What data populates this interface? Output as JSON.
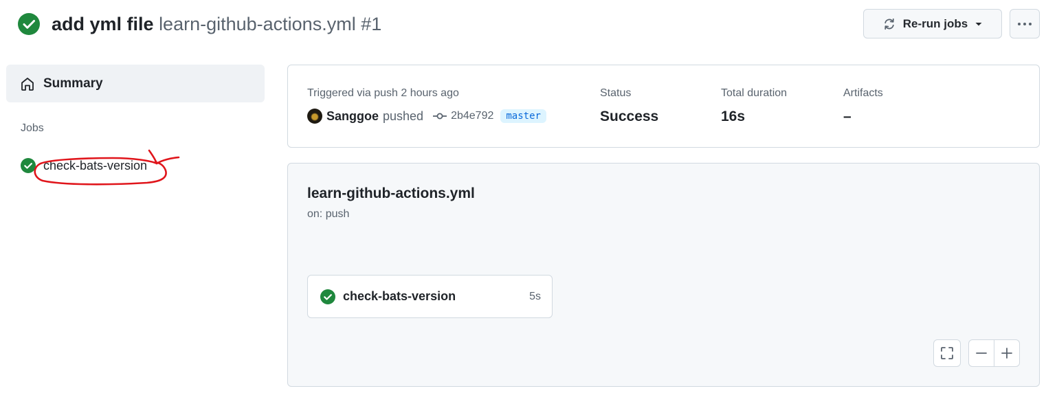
{
  "header": {
    "title": "add yml file",
    "workflow_file": "learn-github-actions.yml",
    "run_number": "#1",
    "rerun_label": "Re-run jobs",
    "status_icon": "check-circle-fill-icon"
  },
  "sidebar": {
    "summary_label": "Summary",
    "jobs_heading": "Jobs",
    "jobs": [
      {
        "name": "check-bats-version",
        "status": "success"
      }
    ]
  },
  "summary": {
    "trigger_text": "Triggered via push 2 hours ago",
    "actor": "Sanggoe",
    "action": "pushed",
    "commit": "2b4e792",
    "branch": "master",
    "status_label": "Status",
    "status_value": "Success",
    "duration_label": "Total duration",
    "duration_value": "16s",
    "artifacts_label": "Artifacts",
    "artifacts_value": "–"
  },
  "graph": {
    "workflow_name": "learn-github-actions.yml",
    "trigger": "on: push",
    "job": {
      "name": "check-bats-version",
      "duration": "5s"
    }
  },
  "colors": {
    "success": "#1f883d",
    "accent": "#0969da",
    "annotation": "#e0151b"
  }
}
